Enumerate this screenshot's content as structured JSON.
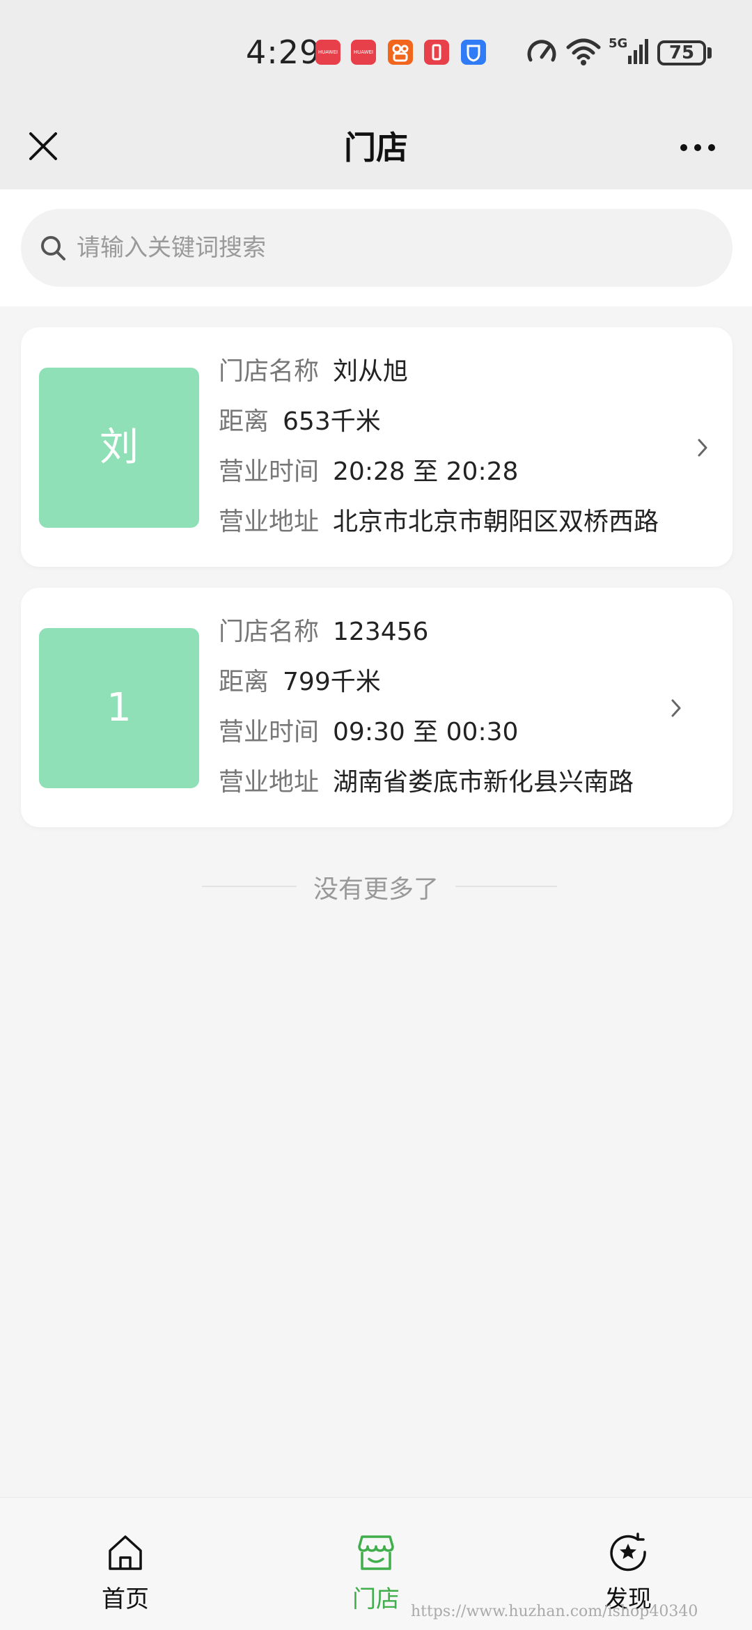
{
  "status_bar": {
    "time": "4:29",
    "battery": "75",
    "network": "5G",
    "app_icons": [
      {
        "name": "huawei-app-icon",
        "label": "HUAWEI",
        "color": "#e8404a"
      },
      {
        "name": "huawei-app-icon-2",
        "label": "HUAWEI",
        "color": "#e8404a"
      },
      {
        "name": "kuaishou-app-icon",
        "label": "",
        "color": "#f2651d"
      },
      {
        "name": "battery-app-icon",
        "label": "",
        "color": "#e8404a"
      },
      {
        "name": "shield-app-icon",
        "label": "",
        "color": "#2f7cf6"
      }
    ]
  },
  "nav": {
    "title": "门店"
  },
  "search": {
    "placeholder": "请输入关键词搜索"
  },
  "stores": [
    {
      "avatar": "刘",
      "name_label": "门店名称",
      "name": "刘从旭",
      "distance_label": "距离",
      "distance": "653千米",
      "hours_label": "营业时间",
      "hours": "20:28 至 20:28",
      "address_label": "营业地址",
      "address": "北京市北京市朝阳区双桥西路"
    },
    {
      "avatar": "1",
      "name_label": "门店名称",
      "name": "123456",
      "distance_label": "距离",
      "distance": "799千米",
      "hours_label": "营业时间",
      "hours": "09:30 至 00:30",
      "address_label": "营业地址",
      "address": "湖南省娄底市新化县兴南路"
    }
  ],
  "footer": {
    "no_more": "没有更多了"
  },
  "tab_bar": {
    "items": [
      {
        "label": "首页",
        "icon": "home-icon",
        "active": false
      },
      {
        "label": "门店",
        "icon": "store-icon",
        "active": true
      },
      {
        "label": "发现",
        "icon": "discover-icon",
        "active": false
      }
    ]
  },
  "colors": {
    "accent": "#3fae4b",
    "avatar_bg": "#8fe0b6"
  },
  "watermark": "https://www.huzhan.com/ishop40340"
}
